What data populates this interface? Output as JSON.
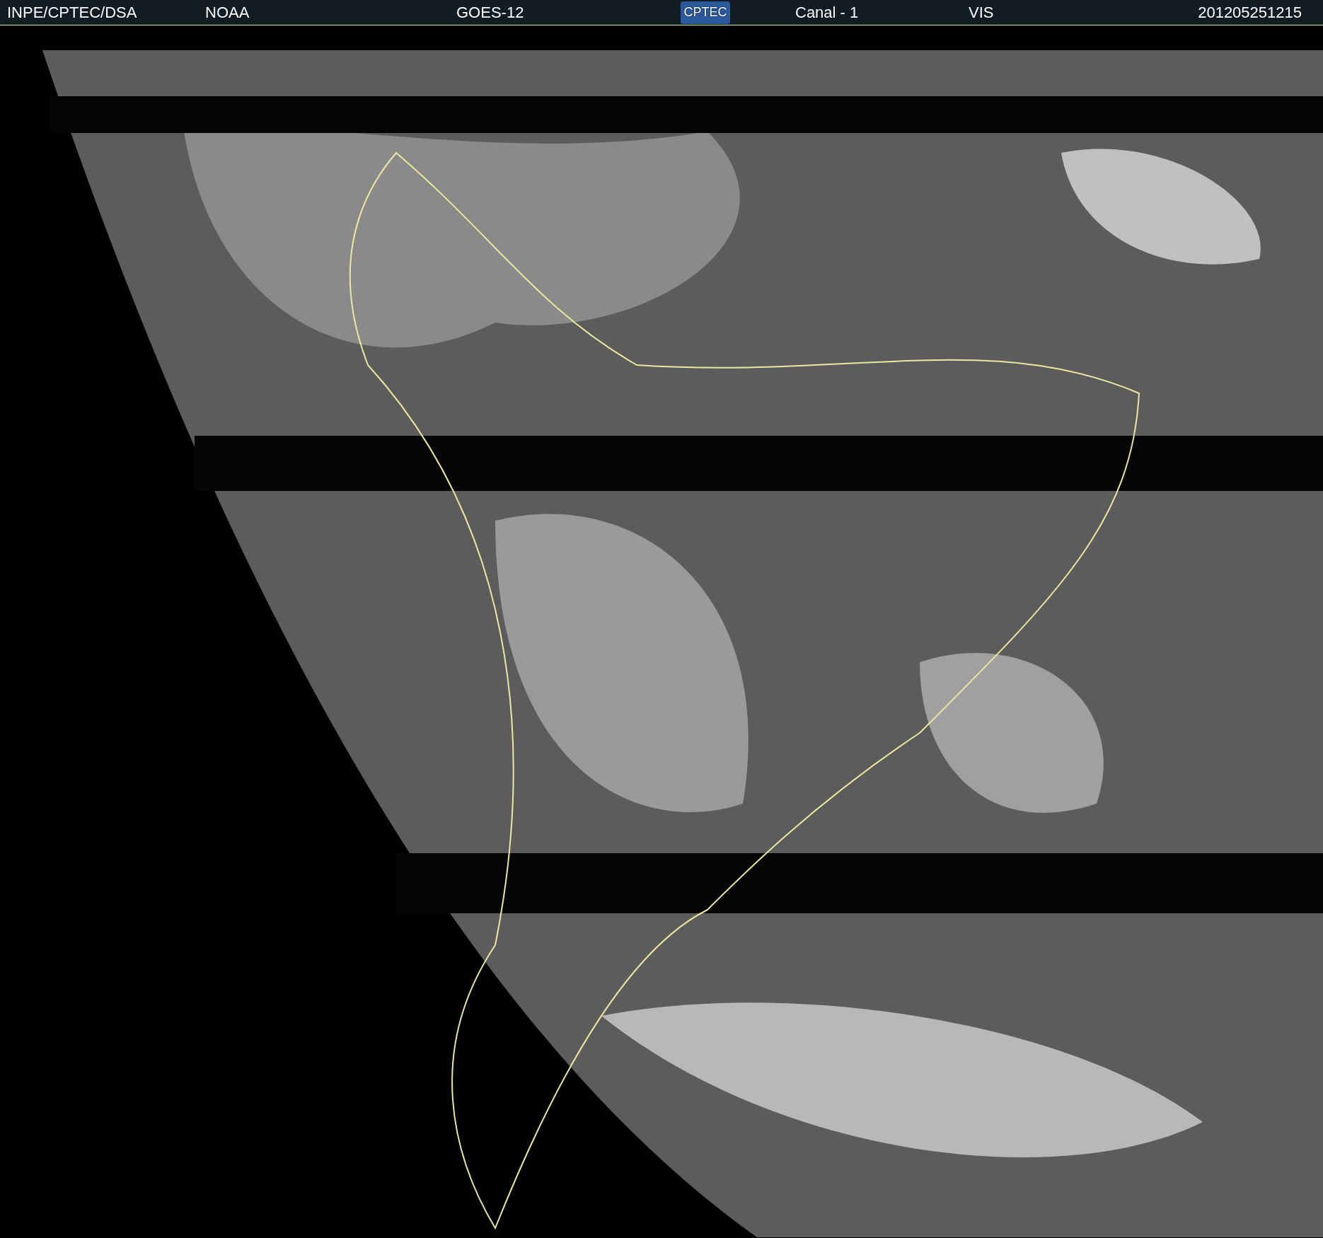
{
  "header": {
    "source": "INPE/CPTEC/DSA",
    "agency": "NOAA",
    "satellite": "GOES-12",
    "logo": "CPTEC",
    "channel": "Canal - 1",
    "band": "VIS",
    "timestamp": "201205251215"
  }
}
